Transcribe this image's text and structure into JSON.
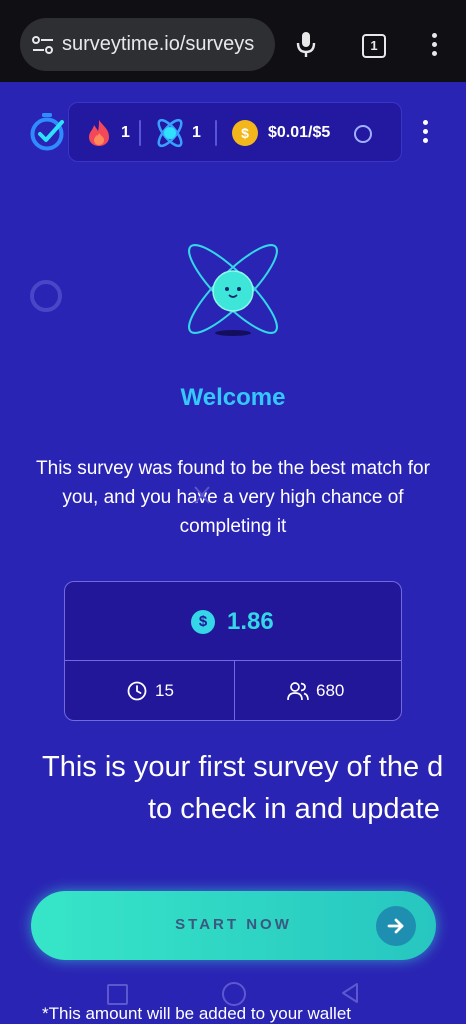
{
  "browser": {
    "url": "surveytime.io/surveys",
    "tab_count": "1"
  },
  "stats": {
    "streak_count": "1",
    "atom_count": "1",
    "coin_symbol": "$",
    "balance": "$0.01/$5"
  },
  "welcome": {
    "title": "Welcome",
    "description": "This survey was found to be the best match for you, and you have a very high chance of completing it"
  },
  "survey": {
    "currency_symbol": "$",
    "reward": "1.86",
    "minutes": "15",
    "participants": "680"
  },
  "notice": {
    "line1": "This is your first survey of the d",
    "line2": "to check in and update"
  },
  "cta": {
    "start_label": "START NOW"
  },
  "footnote": "*This amount will be added to your wallet",
  "colors": {
    "background": "#2a24b4",
    "accent_cyan": "#34c8ff",
    "button_teal": "#37e6c8",
    "coin_gold": "#f3b71c"
  },
  "icons": [
    "tune-icon",
    "mic-icon",
    "tabs-icon",
    "more-vert-icon",
    "timer-check-icon",
    "fire-icon",
    "atom-icon",
    "coin-icon",
    "clock-icon",
    "people-icon",
    "arrow-right-icon"
  ]
}
